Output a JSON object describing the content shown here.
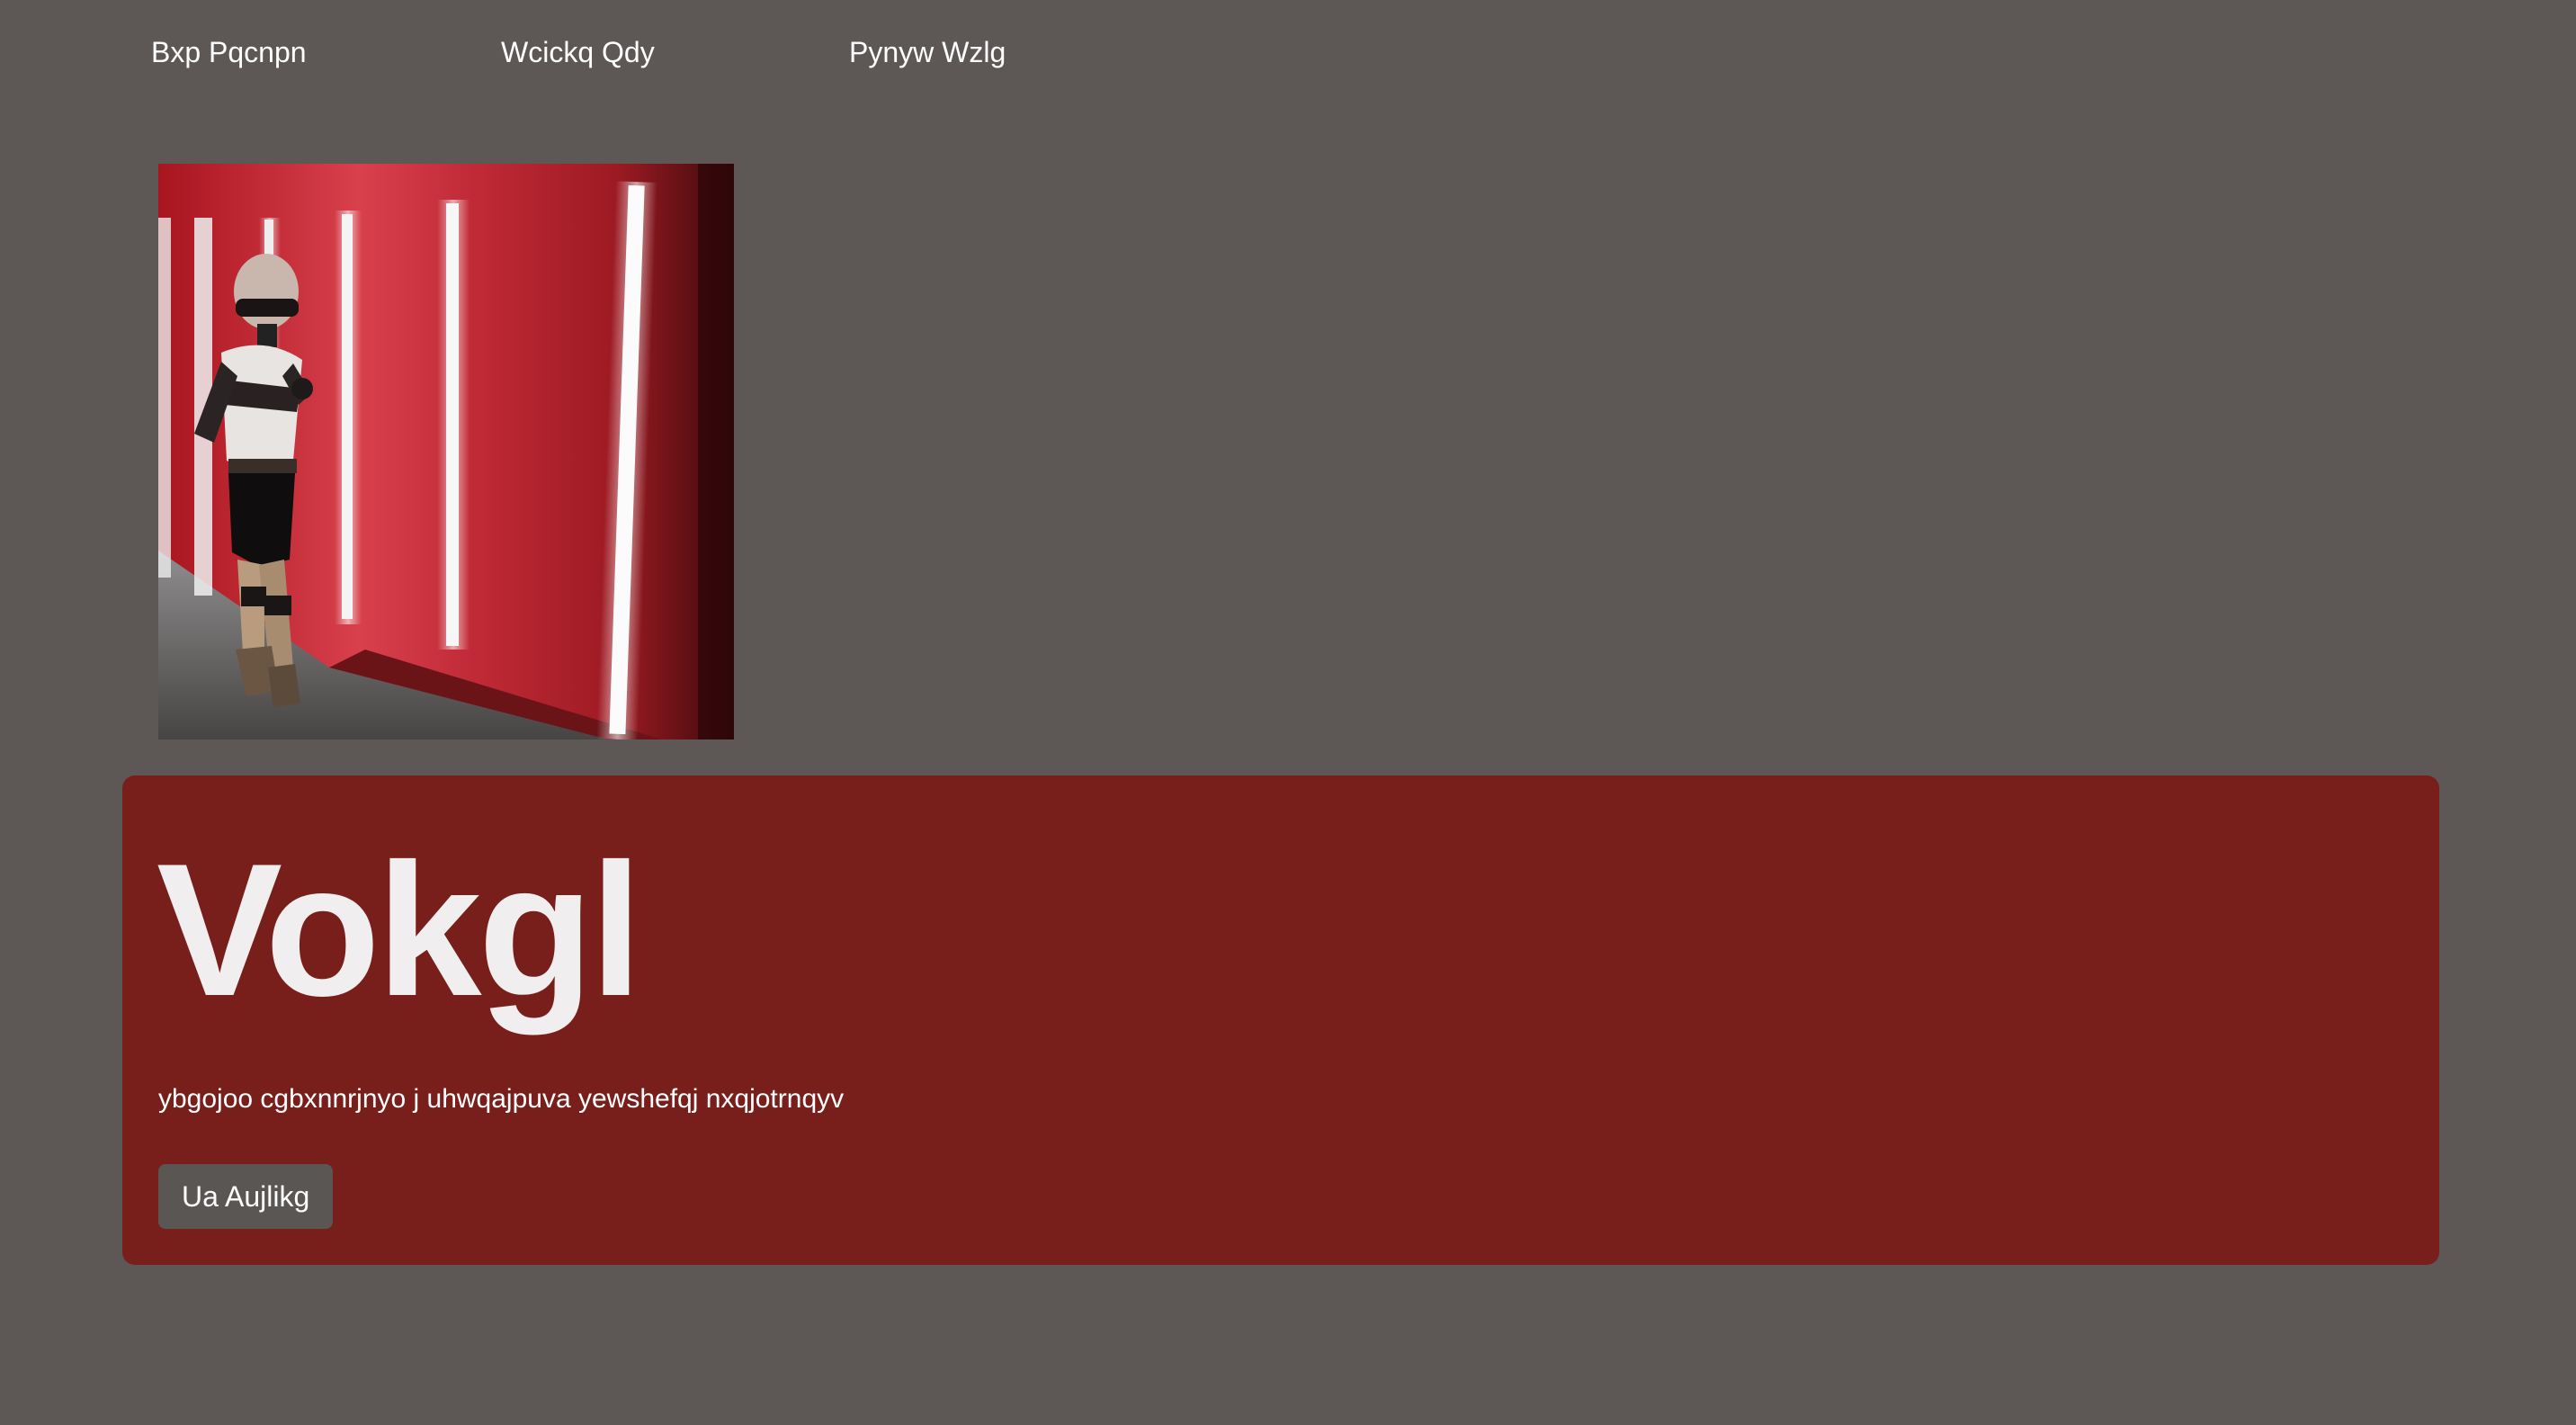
{
  "nav": {
    "items": [
      {
        "label": "Bxp Pqcnpn"
      },
      {
        "label": "Wcickq Qdy"
      },
      {
        "label": "Pynyw Wzlg"
      }
    ]
  },
  "hero": {
    "image_subject": "costumed trooper figure in a red corridor lined with vertical fluorescent light tubes"
  },
  "card": {
    "title": "Vokgl",
    "text": "ybgojoo cgbxnnrjnyo j uhwqajpuva yewshefqj nxqjotrnqyv",
    "button_label": "Ua Aujlikg"
  },
  "colors": {
    "page_background": "#5d5856",
    "card_background": "#781e1b",
    "button_background": "#5a5654",
    "text": "#ffffff"
  }
}
